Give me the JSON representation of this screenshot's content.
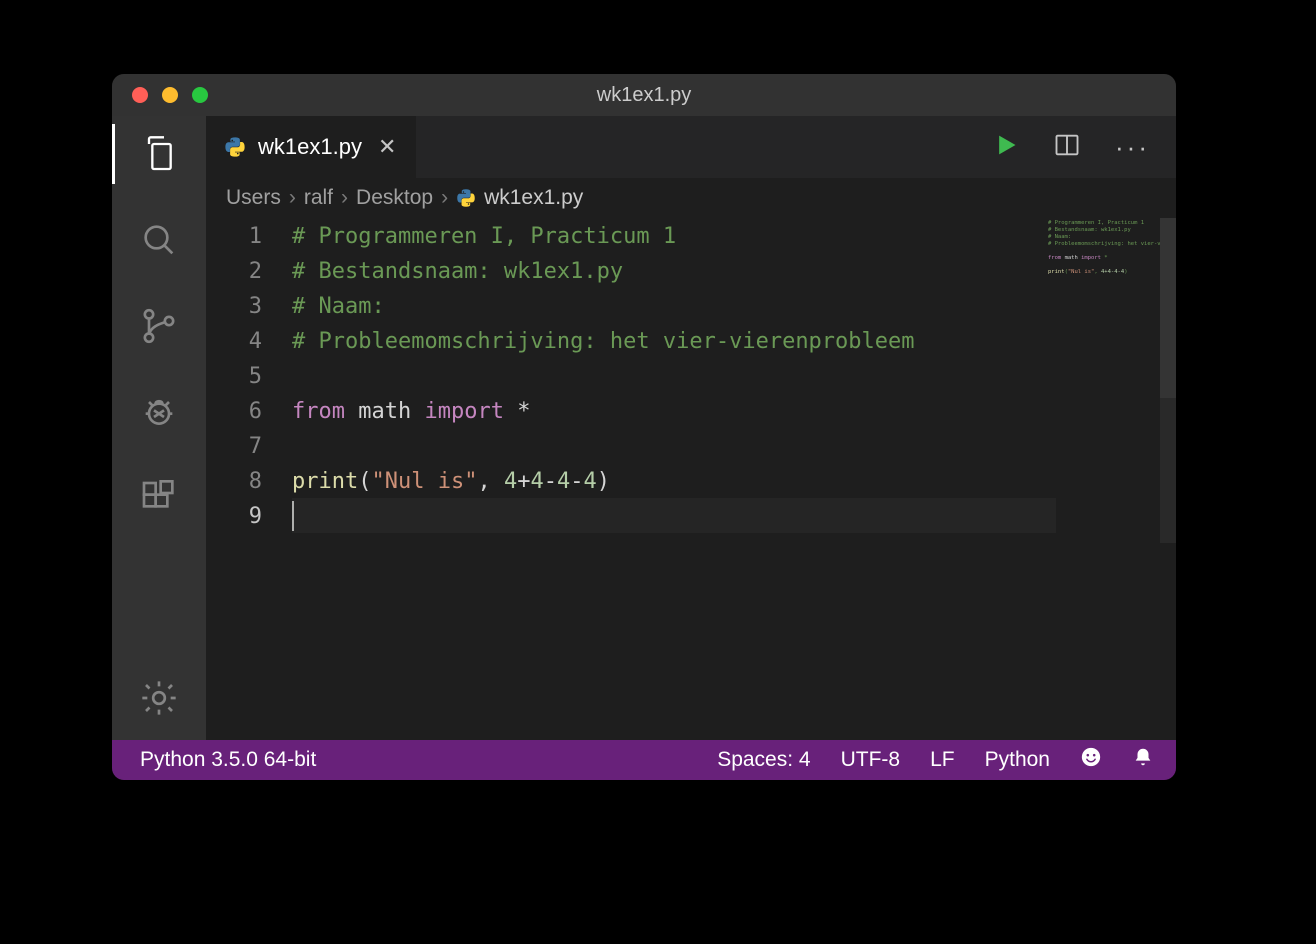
{
  "window": {
    "title": "wk1ex1.py"
  },
  "tab": {
    "filename": "wk1ex1.py"
  },
  "breadcrumb": {
    "segments": [
      "Users",
      "ralf",
      "Desktop"
    ],
    "file": "wk1ex1.py"
  },
  "code": {
    "lines": [
      {
        "n": 1,
        "type": "comment",
        "text": "# Programmeren I, Practicum 1"
      },
      {
        "n": 2,
        "type": "comment",
        "text": "# Bestandsnaam: wk1ex1.py"
      },
      {
        "n": 3,
        "type": "comment",
        "text": "# Naam:"
      },
      {
        "n": 4,
        "type": "comment",
        "text": "# Probleemomschrijving: het vier-vierenprobleem"
      },
      {
        "n": 5,
        "type": "blank",
        "text": ""
      },
      {
        "n": 6,
        "type": "import",
        "kw1": "from",
        "mod": "math",
        "kw2": "import",
        "star": "*"
      },
      {
        "n": 7,
        "type": "blank",
        "text": ""
      },
      {
        "n": 8,
        "type": "print",
        "fn": "print",
        "str": "\"Nul is\"",
        "comma": ", ",
        "expr_nums": [
          "4",
          "4",
          "4",
          "4"
        ],
        "expr_ops": [
          "+",
          "-",
          "-"
        ]
      },
      {
        "n": 9,
        "type": "blank",
        "text": ""
      }
    ],
    "cursor_line": 9
  },
  "statusbar": {
    "interpreter": "Python 3.5.0 64-bit",
    "indent": "Spaces: 4",
    "encoding": "UTF-8",
    "eol": "LF",
    "language": "Python"
  }
}
